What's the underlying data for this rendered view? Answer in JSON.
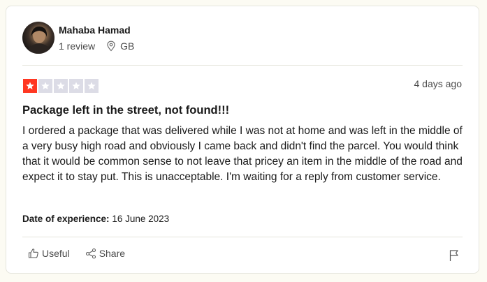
{
  "reviewer": {
    "name": "Mahaba Hamad",
    "review_count": "1 review",
    "country": "GB",
    "avatar_icon": "user-avatar"
  },
  "review": {
    "rating": 1,
    "max_rating": 5,
    "rating_color": "#ff3722",
    "empty_star_color": "#dcdce6",
    "time_ago": "4 days ago",
    "title": "Package left in the street, not found!!!",
    "body": "I ordered a package that was delivered while I was not at home and was left in the middle of a very busy high road and obviously I came back and didn't find the parcel. You would think that it would be common sense to not leave that pricey an item in the middle of the road and expect it to stay put. This is unacceptable. I'm waiting for a reply from customer service.",
    "experience_label": "Date of experience:",
    "experience_date": "16 June 2023"
  },
  "actions": {
    "useful_label": "Useful",
    "share_label": "Share",
    "useful_icon": "thumbs-up-icon",
    "share_icon": "share-icon",
    "flag_icon": "flag-icon"
  }
}
